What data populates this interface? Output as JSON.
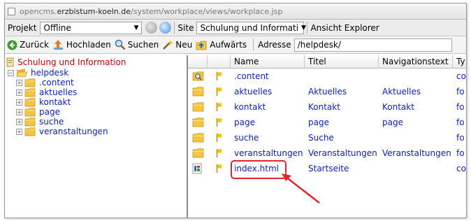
{
  "titlebar": {
    "url_prefix": "opencms.",
    "url_host": "erzbistum-koeln.de",
    "url_path": "/system/workplace/views/workplace.jsp"
  },
  "projectbar": {
    "project_label": "Projekt",
    "project_value": "Offline",
    "site_label": "Site",
    "site_value": "Schulung und Informati",
    "view_label": "Ansicht",
    "view_value": "Explorer"
  },
  "toolbar": {
    "back": "Zurück",
    "upload": "Hochladen",
    "search": "Suchen",
    "new": "Neu",
    "up": "Aufwärts",
    "address_label": "Adresse",
    "address_value": "/helpdesk/"
  },
  "tree": {
    "root": "Schulung und Information",
    "folder": "helpdesk",
    "children": [
      ".content",
      "aktuelles",
      "kontakt",
      "page",
      "suche",
      "veranstaltungen"
    ]
  },
  "list": {
    "headers": {
      "name": "Name",
      "title": "Titel",
      "navtext": "Navigationstext",
      "type": "Ty"
    },
    "rows": [
      {
        "icon": "folder-search-icon",
        "name": ".content",
        "title": "",
        "navtext": "",
        "type": "co"
      },
      {
        "icon": "folder-icon",
        "name": "aktuelles",
        "title": "Aktuelles",
        "navtext": "Aktuelles",
        "type": "fo"
      },
      {
        "icon": "folder-icon",
        "name": "kontakt",
        "title": "Kontakt",
        "navtext": "Kontakt",
        "type": "fo"
      },
      {
        "icon": "folder-icon",
        "name": "page",
        "title": "page",
        "navtext": "page",
        "type": "fo"
      },
      {
        "icon": "folder-icon",
        "name": "suche",
        "title": "Suche",
        "navtext": "",
        "type": "fo"
      },
      {
        "icon": "folder-icon",
        "name": "veranstaltungen",
        "title": "Veranstaltungen",
        "navtext": "Veranstaltungen",
        "type": "fo"
      },
      {
        "icon": "html-file-icon",
        "name": "index.html",
        "title": "Startseite",
        "navtext": "",
        "type": "co"
      }
    ]
  },
  "colors": {
    "link_blue": "#0b1fb8",
    "root_red": "#c00000",
    "highlight_red": "#e0262c",
    "folder_yellow": "#f4c542",
    "flag_yellow": "#f2c200"
  }
}
